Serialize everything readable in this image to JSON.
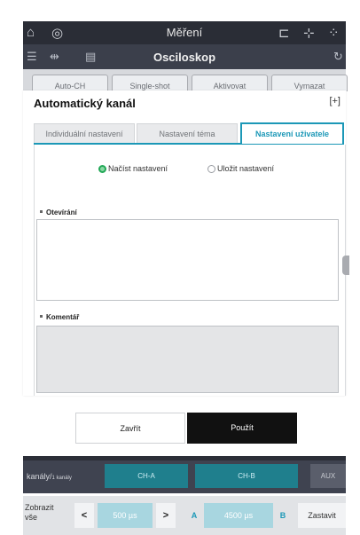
{
  "top_bar": {
    "title": "Měření"
  },
  "scope_bar": {
    "title": "Osciloskop"
  },
  "mode_buttons": [
    "Auto-CH",
    "Single-shot",
    "Aktivovat",
    "Vymazat"
  ],
  "dialog": {
    "title": "Automatický kanál",
    "expand_icon": "[+]",
    "tabs": [
      "Individuální nastavení",
      "Nastavení téma",
      "Nastavení uživatele"
    ],
    "active_tab": 2,
    "radios": [
      {
        "label": "Načíst nastavení",
        "checked": true
      },
      {
        "label": "Uložit nastavení",
        "checked": false
      }
    ],
    "open_label": "Otevírání",
    "comment_label": "Komentář"
  },
  "actions": {
    "close": "Zavřít",
    "apply": "Použít"
  },
  "channel_bar": {
    "label": "kanály/",
    "label_suffix": "1 kanály",
    "channels": [
      "CH-A",
      "CH-B"
    ],
    "aux": "AUX"
  },
  "control_bar": {
    "show_all": "Zobrazit vše",
    "prev": "<",
    "next": ">",
    "timebase": "500 µs",
    "a_label": "A",
    "b_label": "B",
    "position": "4500 µs",
    "stop": "Zastavit"
  },
  "colors": {
    "accent": "#1c98b7",
    "apply_bg": "#111111",
    "radio_on": "#22a857"
  }
}
